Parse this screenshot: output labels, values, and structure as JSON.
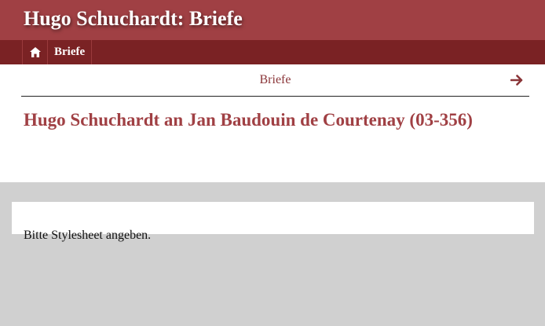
{
  "header": {
    "title": "Hugo Schuchardt: Briefe"
  },
  "nav": {
    "home_icon": "home-icon",
    "items": [
      {
        "label": "Briefe"
      }
    ]
  },
  "breadcrumb": {
    "label": "Briefe",
    "next_icon": "arrow-right-icon"
  },
  "page": {
    "title": "Hugo Schuchardt an Jan Baudouin de Courtenay (03-356)"
  },
  "panel": {
    "message": "Bitte Stylesheet angeben."
  },
  "colors": {
    "header_bg": "#a04044",
    "navbar_bg": "#7a2224",
    "accent": "#a04044",
    "page_bg": "#d0d0d0"
  }
}
